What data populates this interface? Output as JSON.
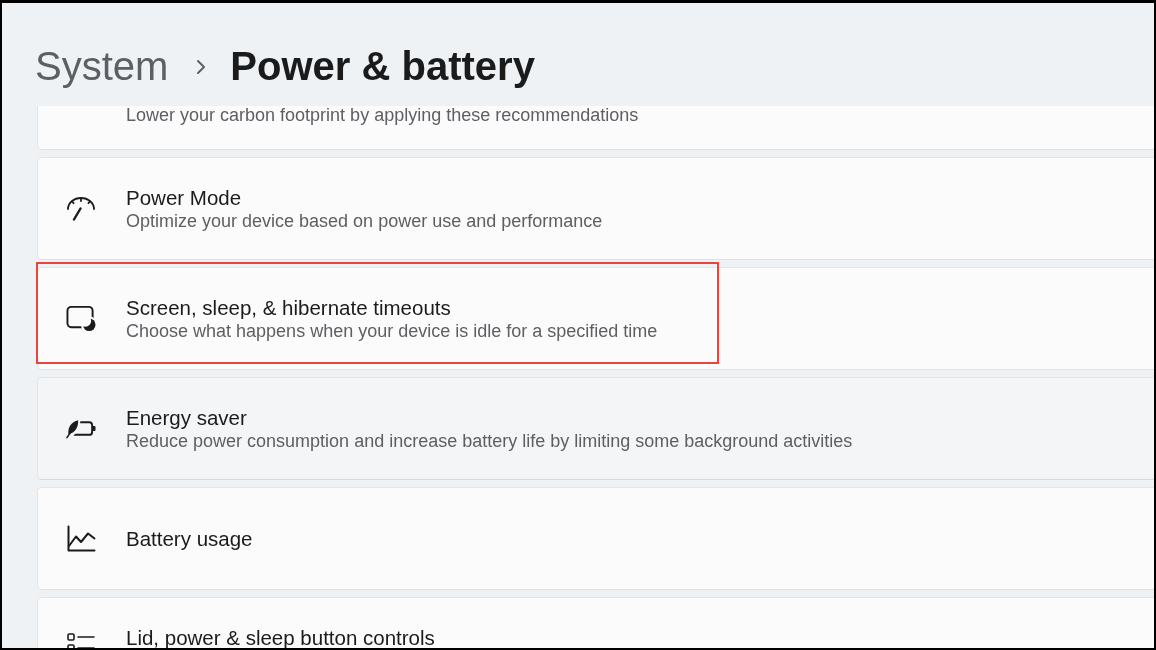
{
  "header": {
    "parent": "System",
    "title": "Power & battery"
  },
  "items": [
    {
      "description": "Lower your carbon footprint by applying these recommendations",
      "hovered": false,
      "highlighted": false
    },
    {
      "title": "Power Mode",
      "description": "Optimize your device based on power use and performance",
      "hovered": false,
      "highlighted": false
    },
    {
      "title": "Screen, sleep, & hibernate timeouts",
      "description": "Choose what happens when your device is idle for a specified time",
      "hovered": false,
      "highlighted": true
    },
    {
      "title": "Energy saver",
      "description": "Reduce power consumption and increase battery life by limiting some background activities",
      "hovered": true,
      "highlighted": false
    },
    {
      "title": "Battery usage",
      "hovered": false,
      "highlighted": false
    },
    {
      "title": "Lid, power & sleep button controls",
      "hovered": false,
      "highlighted": false
    }
  ]
}
